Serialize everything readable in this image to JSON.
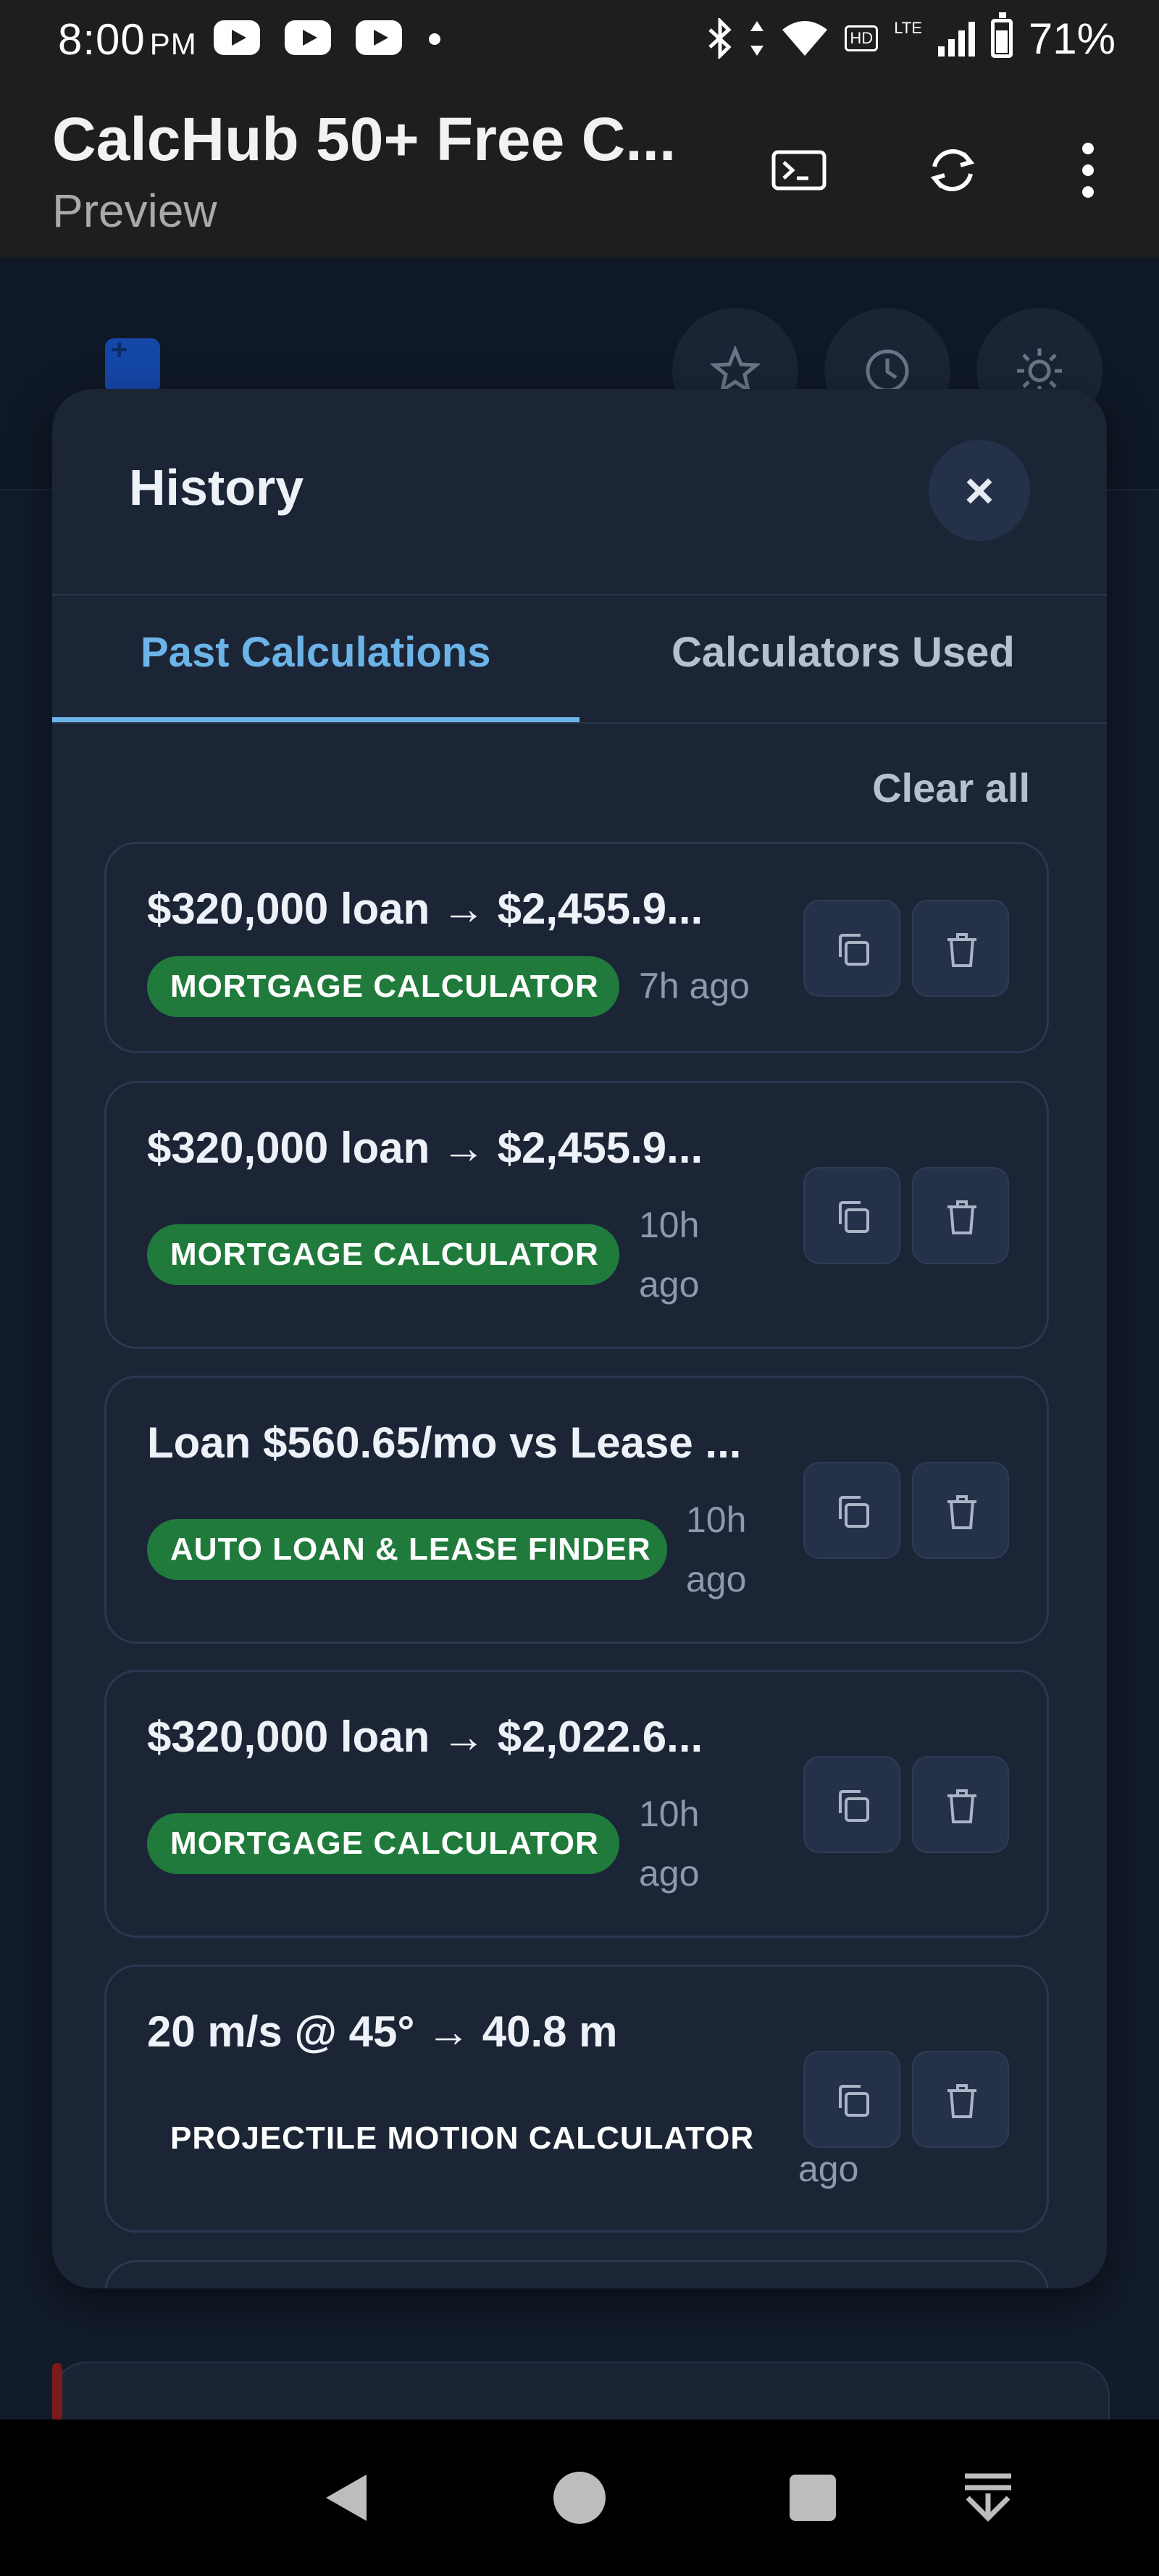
{
  "status_bar": {
    "time": "8:00",
    "ampm": "PM",
    "battery": "71%",
    "network": "LTE",
    "hd_badge": "HD"
  },
  "app_bar": {
    "title": "CalcHub 50+ Free C...",
    "subtitle": "Preview",
    "icons": [
      "terminal-icon",
      "refresh-icon",
      "more-vert-icon"
    ]
  },
  "page_header": {
    "icons": [
      "favorites-star-icon",
      "history-clock-icon",
      "theme-sun-icon"
    ]
  },
  "history_modal": {
    "title": "History",
    "close_label": "×",
    "tabs": [
      {
        "label": "Past Calculations",
        "active": true
      },
      {
        "label": "Calculators Used",
        "active": false
      }
    ],
    "clear_all_label": "Clear all",
    "entries": [
      {
        "title": "$320,000 loan → $2,455.9...",
        "calculator": "MORTGAGE CALCULATOR",
        "time": "7h ago"
      },
      {
        "title": "$320,000 loan → $2,455.9...",
        "calculator": "MORTGAGE CALCULATOR",
        "time_line1": "10h",
        "time_line2": "ago"
      },
      {
        "title": "Loan $560.65/mo vs Lease ...",
        "calculator": "AUTO LOAN & LEASE FINDER",
        "time_line1": "10h",
        "time_line2": "ago"
      },
      {
        "title": "$320,000 loan → $2,022.6...",
        "calculator": "MORTGAGE CALCULATOR",
        "time_line1": "10h",
        "time_line2": "ago"
      },
      {
        "title": "20 m/s @ 45° → 40.8 m",
        "calculator": "PROJECTILE MOTION CALCULATOR",
        "time_line2": "ago"
      }
    ]
  },
  "colors": {
    "accent": "#6cb4e8",
    "badge_green": "#207a3c",
    "modal_bg": "#1b2536",
    "page_bg": "#131c2b"
  }
}
